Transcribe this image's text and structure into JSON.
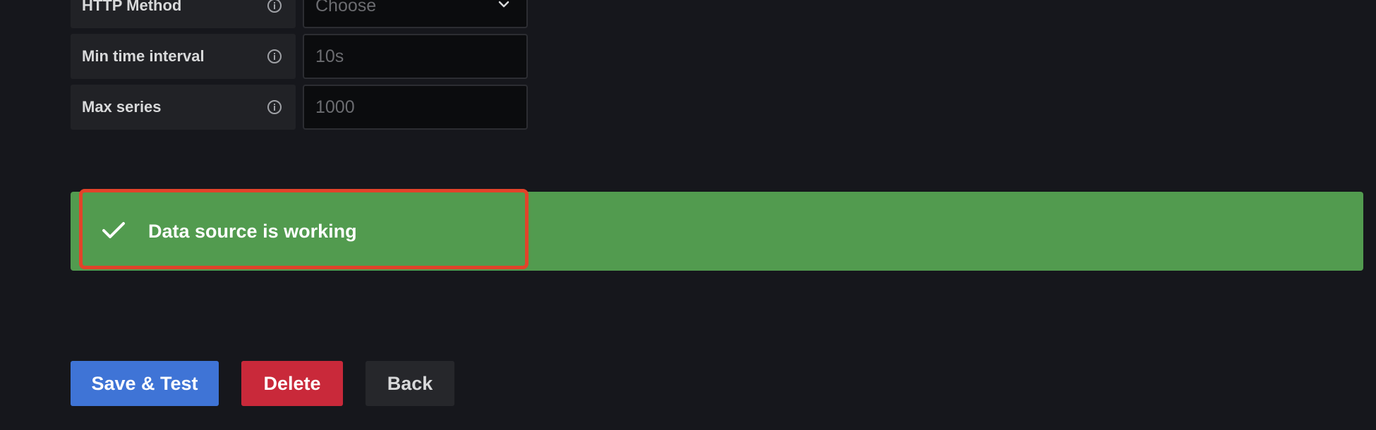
{
  "form": {
    "rows": [
      {
        "label": "HTTP Method",
        "value": "Choose",
        "type": "select"
      },
      {
        "label": "Min time interval",
        "value": "10s",
        "type": "input"
      },
      {
        "label": "Max series",
        "value": "1000",
        "type": "input"
      }
    ]
  },
  "alert": {
    "message": "Data source is working",
    "status": "success",
    "color": "#529b4f",
    "highlight_color": "#e2432a"
  },
  "actions": {
    "save_label": "Save & Test",
    "delete_label": "Delete",
    "back_label": "Back"
  },
  "icons": {
    "info": "info-circle-icon",
    "check": "check-icon",
    "chevron": "chevron-down-icon"
  }
}
